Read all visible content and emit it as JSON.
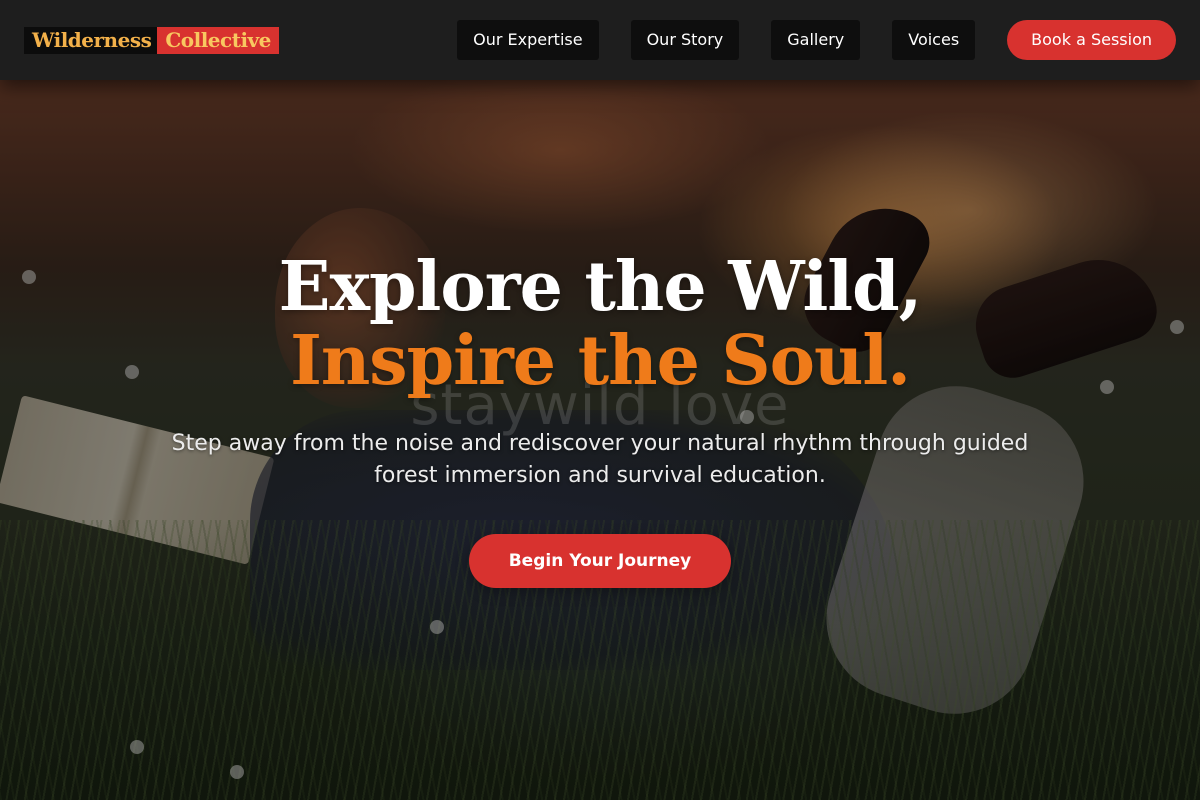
{
  "header": {
    "logo_part1": "Wilderness",
    "logo_part2": "Collective",
    "nav": [
      {
        "label": "Our Expertise"
      },
      {
        "label": "Our Story"
      },
      {
        "label": "Gallery"
      },
      {
        "label": "Voices"
      }
    ],
    "cta_label": "Book a Session"
  },
  "hero": {
    "watermark": "staywild love",
    "headline_part1": "Explore the Wild, ",
    "headline_accent": "Inspire the Soul.",
    "subtitle": "Step away from the noise and rediscover your natural rhythm through guided forest immersion and survival education.",
    "cta_label": "Begin Your Journey",
    "background_image": "girl-reading-in-meadow-at-sunset"
  },
  "colors": {
    "header_bg": "#1e1e1e",
    "accent_red": "#d8322f",
    "accent_orange": "#ef7b1a",
    "logo_yellow": "#f3b14a"
  }
}
